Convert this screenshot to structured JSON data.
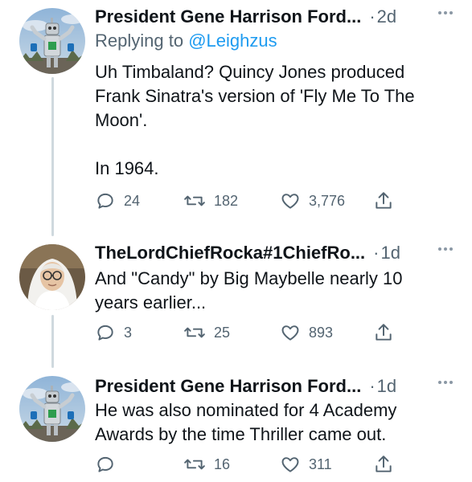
{
  "tweets": [
    {
      "name": "President Gene Harrison Ford...",
      "dot": "·",
      "time": "2d",
      "replying_prefix": "Replying to ",
      "replying_handle": "@Leighzus",
      "text_lines": [
        "Uh Timbaland? Quincy Jones produced",
        "Frank Sinatra's version of 'Fly Me To The",
        "Moon'.",
        "",
        "In 1964."
      ],
      "replies": "24",
      "retweets": "182",
      "likes": "3,776",
      "avatar": "robot-statue-avatar"
    },
    {
      "name": "TheLordChiefRocka#1ChiefRo...",
      "dot": "·",
      "time": "1d",
      "text_lines": [
        "And \"Candy\" by Big Maybelle nearly 10",
        "years earlier..."
      ],
      "replies": "3",
      "retweets": "25",
      "likes": "893",
      "avatar": "person-with-glasses-avatar"
    },
    {
      "name": "President Gene Harrison Ford...",
      "dot": "·",
      "time": "1d",
      "text_lines": [
        "He was also nominated for 4 Academy",
        "Awards by the time Thriller came out."
      ],
      "replies": "",
      "retweets": "16",
      "likes": "311",
      "avatar": "robot-statue-avatar"
    }
  ],
  "icons": {
    "reply": "reply-icon",
    "retweet": "retweet-icon",
    "like": "heart-icon",
    "share": "share-icon",
    "more": "more-icon"
  },
  "colors": {
    "text": "#0f1419",
    "secondary": "#536471",
    "link": "#1d9bf0",
    "thread_line": "#cfd9de"
  }
}
